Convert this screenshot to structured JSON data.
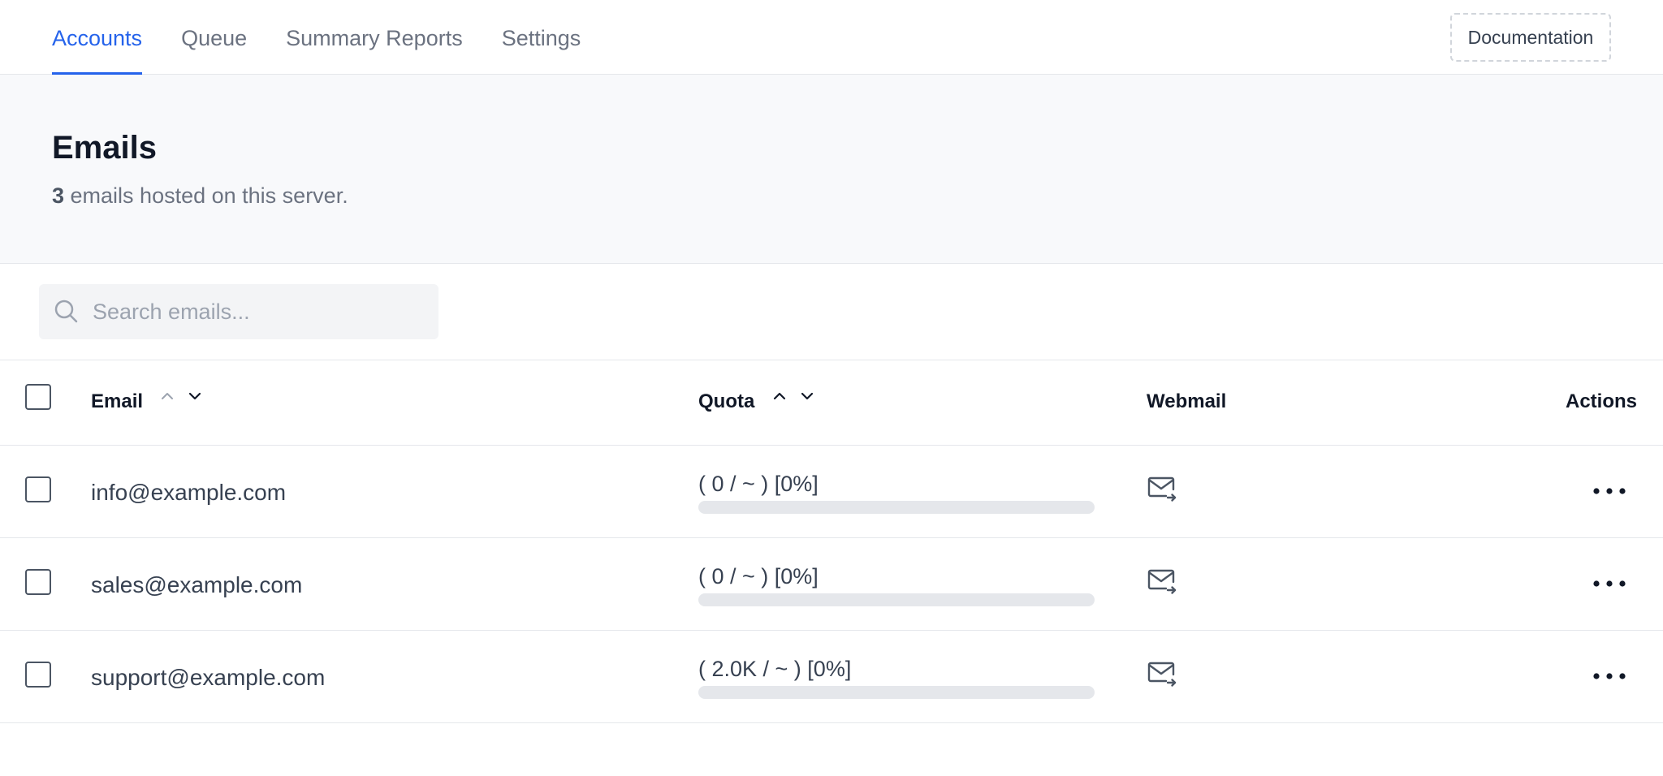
{
  "nav": {
    "tabs": [
      {
        "label": "Accounts",
        "active": true
      },
      {
        "label": "Queue",
        "active": false
      },
      {
        "label": "Summary Reports",
        "active": false
      },
      {
        "label": "Settings",
        "active": false
      }
    ],
    "documentation_label": "Documentation"
  },
  "header": {
    "title": "Emails",
    "count": "3",
    "subtitle": " emails hosted on this server."
  },
  "search": {
    "placeholder": "Search emails...",
    "value": ""
  },
  "table": {
    "columns": {
      "email": "Email",
      "quota": "Quota",
      "webmail": "Webmail",
      "actions": "Actions"
    },
    "rows": [
      {
        "email": "info@example.com",
        "quota": "( 0 / ~ ) [0%]",
        "quota_percent": 0
      },
      {
        "email": "sales@example.com",
        "quota": "( 0 / ~ ) [0%]",
        "quota_percent": 0
      },
      {
        "email": "support@example.com",
        "quota": "( 2.0K / ~ ) [0%]",
        "quota_percent": 0
      }
    ]
  },
  "icons": {
    "search": "search-icon",
    "webmail": "mail-forward-icon",
    "actions": "more-horizontal-icon",
    "sort_up": "chevron-up-icon",
    "sort_down": "chevron-down-icon"
  },
  "colors": {
    "accent": "#2563eb",
    "header_bg": "#f8f9fb",
    "border": "#e5e7eb"
  }
}
